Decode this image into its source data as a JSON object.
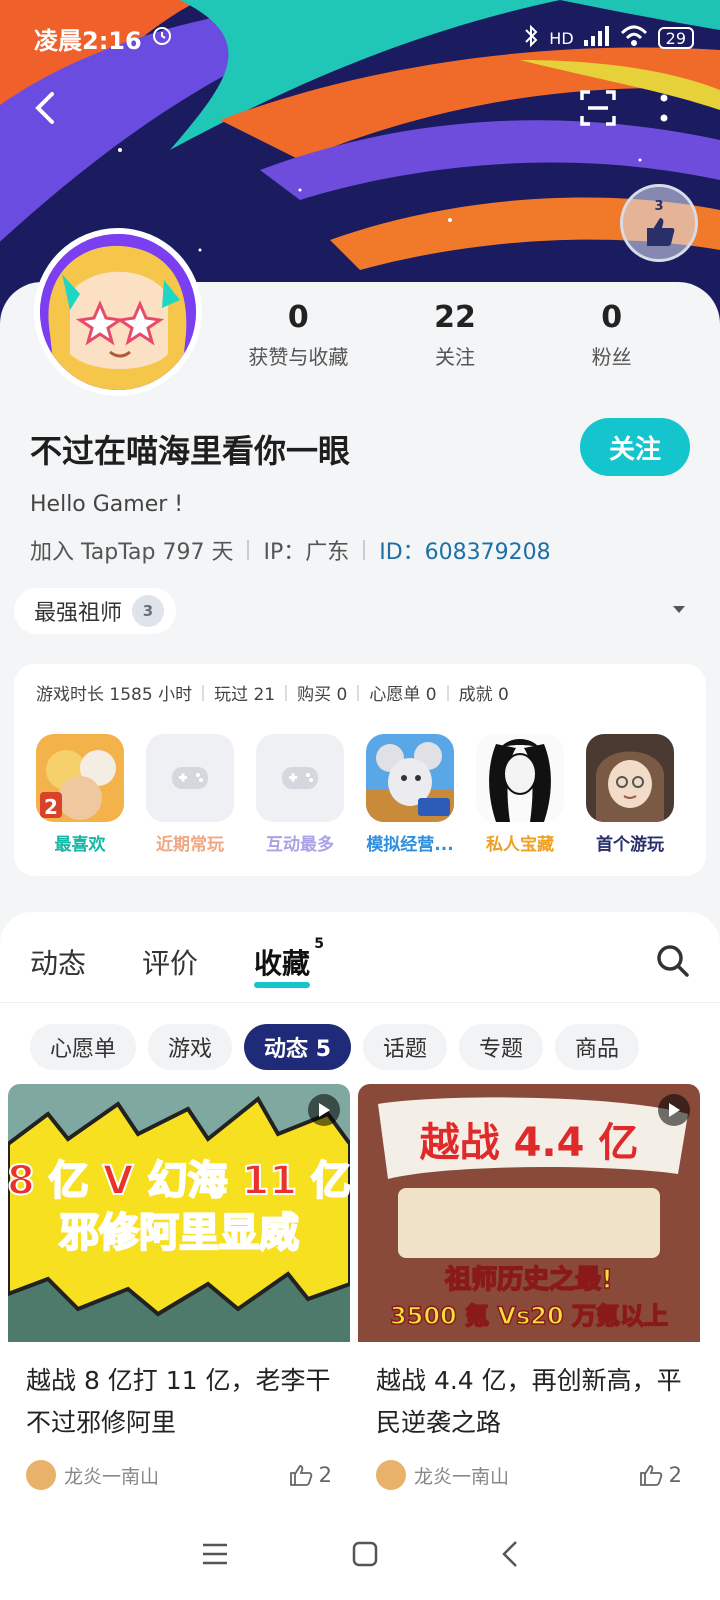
{
  "status_bar": {
    "time": "凌晨2:16",
    "network": "HD",
    "battery": "29"
  },
  "profile": {
    "stats": [
      {
        "value": "0",
        "label": "获赞与收藏"
      },
      {
        "value": "22",
        "label": "关注"
      },
      {
        "value": "0",
        "label": "粉丝"
      }
    ],
    "nickname": "不过在喵海里看你一眼",
    "follow_label": "关注",
    "bio": "Hello Gamer !",
    "joined": "加入 TapTap 797 天",
    "ip": "IP：广东",
    "id": "ID：608379208",
    "title": "最强祖师",
    "title_level": "3",
    "medal_level": "3"
  },
  "games": {
    "stats": [
      "游戏时长 1585 小时",
      "玩过 21",
      "购买 0",
      "心愿单 0",
      "成就 0"
    ],
    "items": [
      {
        "label": "最喜欢",
        "color": "#16b8a5"
      },
      {
        "label": "近期常玩",
        "color": "#f0a882"
      },
      {
        "label": "互动最多",
        "color": "#a9a3e6"
      },
      {
        "label": "模拟经营...",
        "color": "#2f8fe0"
      },
      {
        "label": "私人宝藏",
        "color": "#f0a020"
      },
      {
        "label": "首个游玩",
        "color": "#2a2f6e"
      }
    ]
  },
  "feed": {
    "tabs": [
      {
        "label": "动态"
      },
      {
        "label": "评价"
      },
      {
        "label": "收藏",
        "count": "5"
      }
    ],
    "chips": [
      "心愿单",
      "游戏",
      "动态 5",
      "话题",
      "专题",
      "商品"
    ],
    "cards": [
      {
        "title": "越战 8 亿打 11 亿，老李干不过邪修阿里",
        "thumb_line1": "8 亿 V 幻海 11 亿",
        "thumb_line2": "邪修阿里显威",
        "author": "龙炎一南山",
        "likes": "2"
      },
      {
        "title": "越战 4.4 亿，再创新高，平民逆袭之路",
        "thumb_line1": "越战 4.4 亿",
        "thumb_line2": "祖师历史之最!",
        "thumb_line3": "3500 氪 Vs20 万氪以上",
        "author": "龙炎一南山",
        "likes": "2"
      }
    ]
  },
  "colors": {
    "accent": "#15c5ce",
    "navy": "#1f2a79",
    "link": "#1d6fa6"
  }
}
